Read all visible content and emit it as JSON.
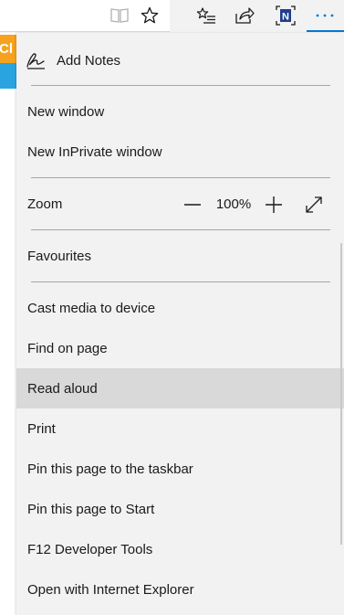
{
  "toolbar": {
    "icons": [
      "reading-view-icon",
      "favorite-star-icon",
      "favorites-hub-icon",
      "share-icon",
      "onenote-extension-icon",
      "more-actions-icon"
    ],
    "extension_letter": "N",
    "accent_color": "#0078d7"
  },
  "page_peek": {
    "banner_text": "Cl",
    "banner_color": "#f6a21e",
    "strip_color": "#2aa4e0"
  },
  "menu": {
    "add_notes": "Add Notes",
    "new_window": "New window",
    "new_inprivate_window": "New InPrivate window",
    "zoom": {
      "label": "Zoom",
      "value": "100%"
    },
    "favourites": "Favourites",
    "cast_media": "Cast media to device",
    "find_on_page": "Find on page",
    "read_aloud": "Read aloud",
    "print": "Print",
    "pin_taskbar": "Pin this page to the taskbar",
    "pin_start": "Pin this page to Start",
    "dev_tools": "F12 Developer Tools",
    "open_ie": "Open with Internet Explorer",
    "highlighted_item": "Read aloud",
    "highlight_color": "#d9d9d9"
  }
}
